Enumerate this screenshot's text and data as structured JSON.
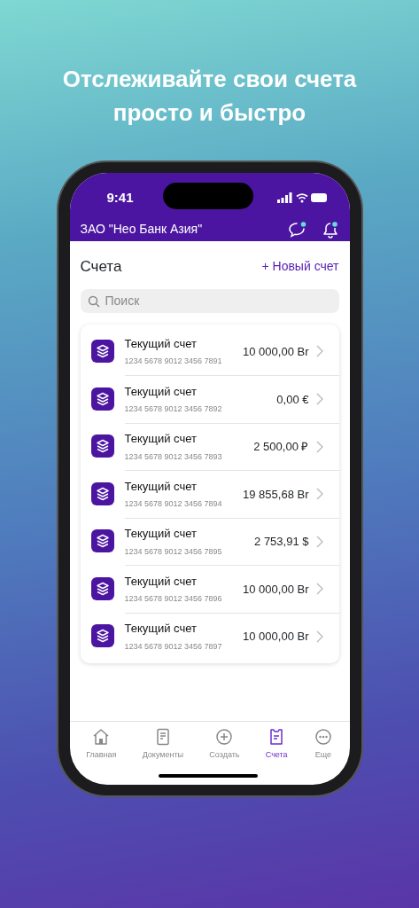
{
  "headline": "Отслеживайте свои счета просто и быстро",
  "status_bar": {
    "time": "9:41"
  },
  "header": {
    "title": "ЗАО \"Нео Банк Азия\""
  },
  "page": {
    "title": "Счета",
    "action": "+ Новый счет"
  },
  "search": {
    "placeholder": "Поиск"
  },
  "accounts": [
    {
      "name": "Текущий счет",
      "number": "1234 5678 9012 3456 7891",
      "balance": "10 000,00 Br"
    },
    {
      "name": "Текущий счет",
      "number": "1234 5678 9012 3456 7892",
      "balance": "0,00 €"
    },
    {
      "name": "Текущий счет",
      "number": "1234 5678 9012 3456 7893",
      "balance": "2 500,00 ₽"
    },
    {
      "name": "Текущий счет",
      "number": "1234 5678 9012 3456 7894",
      "balance": "19 855,68 Br"
    },
    {
      "name": "Текущий счет",
      "number": "1234 5678 9012 3456 7895",
      "balance": "2 753,91 $"
    },
    {
      "name": "Текущий счет",
      "number": "1234 5678 9012 3456 7896",
      "balance": "10 000,00 Br"
    },
    {
      "name": "Текущий счет",
      "number": "1234 5678 9012 3456 7897",
      "balance": "10 000,00 Br"
    }
  ],
  "tab_bar": [
    {
      "label": "Главная",
      "kind": "home",
      "selected": false
    },
    {
      "label": "Документы",
      "kind": "documents",
      "selected": false
    },
    {
      "label": "Создать",
      "kind": "create",
      "selected": false
    },
    {
      "label": "Счета",
      "kind": "accounts",
      "selected": true
    },
    {
      "label": "Еще",
      "kind": "more",
      "selected": false
    }
  ]
}
